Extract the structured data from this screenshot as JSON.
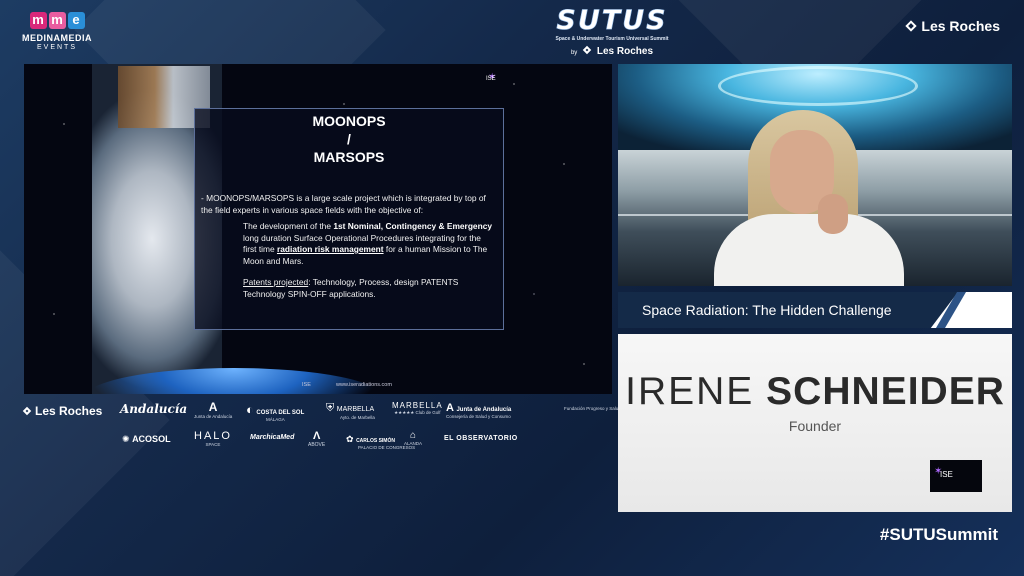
{
  "header": {
    "mme": {
      "letters": [
        "m",
        "m",
        "e"
      ],
      "line1": "MEDINAMEDIA",
      "line2": "EVENTS"
    },
    "sutus": {
      "title": "SUTUS",
      "subtitle": "Space & Underwater Tourism Universal Summit",
      "by": "by",
      "brand": "Les Roches"
    },
    "top_right_brand": "Les Roches"
  },
  "slide": {
    "title_line1": "MOONOPS",
    "title_sep": "/",
    "title_line2": "MARSOPS",
    "intro": "- MOONOPS/MARSOPS is a large scale project which is integrated by top of the field experts in various space fields with the objective of:",
    "p1_start": "The development of the ",
    "p1_bold": "1st Nominal, Contingency & Emergency",
    "p1_mid": " long duration Surface Operational Procedures integrating for the first time ",
    "p1_bold2": "radiation risk management",
    "p1_end": " for a human Mission to The Moon and Mars.",
    "p2_label": "Patents projected",
    "p2_text": ": Technology, Process, design PATENTS Technology SPIN-OFF applications.",
    "logo_text": "ISE",
    "footer_left": "ISE",
    "footer_right": "www.iseradiations.com"
  },
  "sponsors": {
    "row1": [
      {
        "name": "Les Roches"
      },
      {
        "name": "Andalucía"
      },
      {
        "name": "A",
        "sub": "Junta de Andalucía"
      },
      {
        "name": "COSTA DEL SOL",
        "sub": "MÁLAGA"
      },
      {
        "name": "MARBELLA",
        "sub": "Ayto. de Marbella"
      },
      {
        "name": "MARBELLA",
        "sub": "★★★★★ Club de Golf"
      },
      {
        "name": "Junta de Andalucía",
        "sub": "Consejería de Salud y Consumo"
      },
      {
        "name": "",
        "sub": "Fundación Progreso y Salud"
      }
    ],
    "row2": [
      {
        "name": "ACOSOL"
      },
      {
        "name": "HALO",
        "sub": "SPACE"
      },
      {
        "name": "MarchicaMed"
      },
      {
        "name": "ABOVE"
      },
      {
        "name": "CARLOS SIMÓN",
        "sub": "PALACIO DE CONGRESOS"
      },
      {
        "name": "ALANDA",
        "sub": "HOTEL"
      },
      {
        "name": "EL OBSERVATORIO"
      }
    ]
  },
  "lower_third": {
    "topic": "Space Radiation: The Hidden Challenge",
    "first_name": "IRENE",
    "last_name": "SCHNEIDER",
    "role": "Founder",
    "badge": "ISE"
  },
  "hashtag": "#SUTUSummit",
  "colors": {
    "background": "#14294a",
    "lower_third_bar": "#142a48",
    "mme_pink": "#d9287a",
    "mme_blue": "#2a8fd8",
    "ise_star": "#b06bff"
  }
}
